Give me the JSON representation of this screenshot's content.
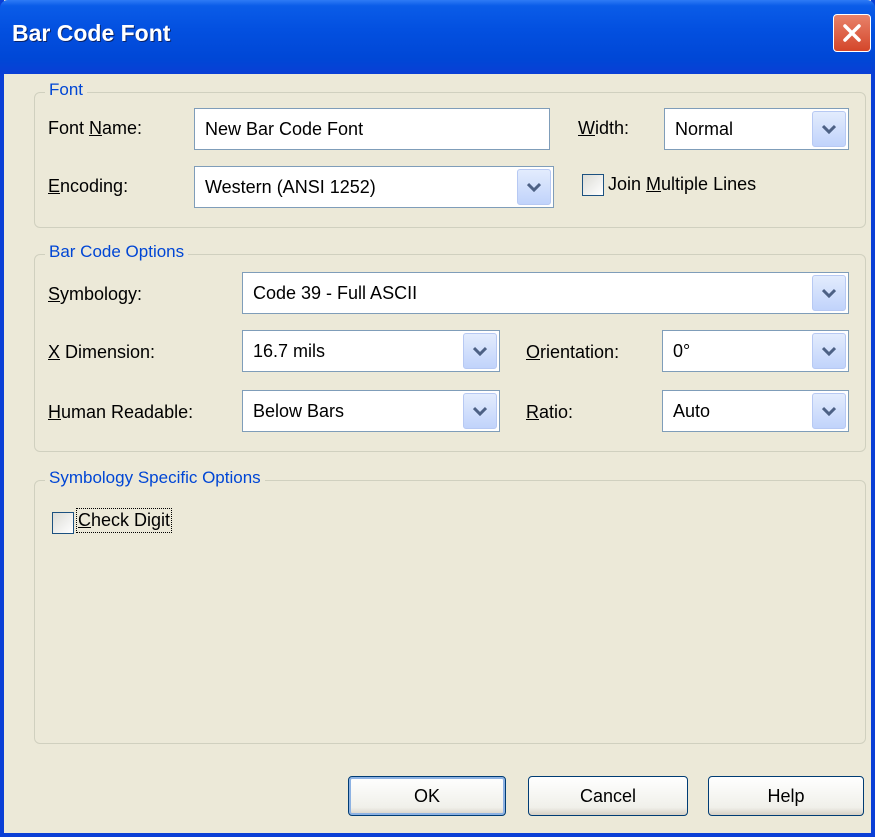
{
  "window": {
    "title": "Bar Code Font"
  },
  "font_group": {
    "legend": "Font",
    "font_name_label_pre": "Font ",
    "font_name_label_ul": "N",
    "font_name_label_post": "ame:",
    "font_name_value": "New Bar Code Font",
    "width_label_ul": "W",
    "width_label_post": "idth:",
    "width_value": "Normal",
    "encoding_label_ul": "E",
    "encoding_label_post": "ncoding:",
    "encoding_value": "Western (ANSI 1252)",
    "join_label_pre": "Join ",
    "join_label_ul": "M",
    "join_label_post": "ultiple Lines",
    "join_checked": false
  },
  "options_group": {
    "legend": "Bar Code Options",
    "symbology_label_ul": "S",
    "symbology_label_post": "ymbology:",
    "symbology_value": "Code 39 - Full ASCII",
    "xdim_label_ul": "X",
    "xdim_label_post": " Dimension:",
    "xdim_value": "16.7 mils",
    "orientation_label_ul": "O",
    "orientation_label_post": "rientation:",
    "orientation_value": "0°",
    "human_label_ul": "H",
    "human_label_post": "uman Readable:",
    "human_value": "Below Bars",
    "ratio_label_ul": "R",
    "ratio_label_post": "atio:",
    "ratio_value": "Auto"
  },
  "specific_group": {
    "legend": "Symbology Specific Options",
    "check_digit_label_ul": "C",
    "check_digit_label_post": "heck Digit",
    "check_digit_checked": false
  },
  "buttons": {
    "ok": "OK",
    "cancel": "Cancel",
    "help": "Help"
  }
}
